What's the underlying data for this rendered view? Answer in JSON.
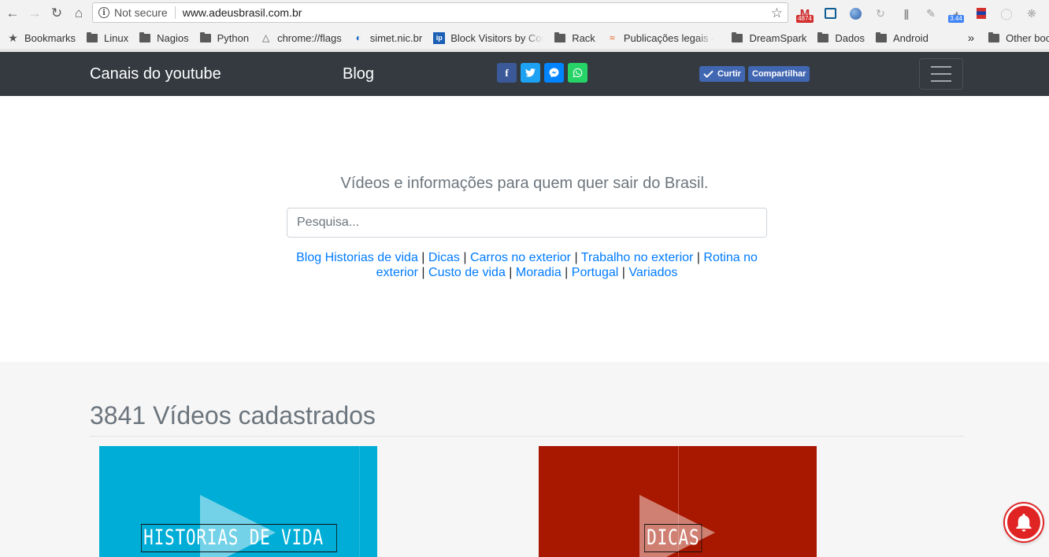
{
  "browser": {
    "security_label": "Not secure",
    "url": "www.adeusbrasil.com.br",
    "extensions": [
      {
        "name": "gmail-extension-icon",
        "badge": "4874",
        "badge_color": "#d32f2f"
      },
      {
        "name": "screenshot-extension-icon"
      },
      {
        "name": "globe-extension-icon"
      },
      {
        "name": "refresh-extension-icon"
      },
      {
        "name": "barcode-extension-icon"
      },
      {
        "name": "pen-extension-icon"
      },
      {
        "name": "speed-extension-icon",
        "badge": "3.44",
        "badge_color": "#4285f4"
      },
      {
        "name": "flag-extension-icon"
      },
      {
        "name": "circle-extension-icon"
      },
      {
        "name": "react-extension-icon"
      }
    ]
  },
  "bookmarks": {
    "label": "Bookmarks",
    "items": [
      {
        "label": "Linux",
        "icon": "folder"
      },
      {
        "label": "Nagios",
        "icon": "folder"
      },
      {
        "label": "Python",
        "icon": "folder"
      },
      {
        "label": "chrome://flags",
        "icon": "flask"
      },
      {
        "label": "simet.nic.br",
        "icon": "gauge"
      },
      {
        "label": "Block Visitors by Cou",
        "icon": "ip"
      },
      {
        "label": "Rack",
        "icon": "folder"
      },
      {
        "label": "Publicações legais -",
        "icon": "wave"
      },
      {
        "label": "DreamSpark",
        "icon": "folder"
      },
      {
        "label": "Dados",
        "icon": "folder"
      },
      {
        "label": "Android",
        "icon": "folder"
      }
    ],
    "overflow": "»",
    "other": "Other bookmarks"
  },
  "navbar": {
    "link1": "Canais do youtube",
    "link2": "Blog",
    "share": {
      "facebook": "f",
      "twitter": "t",
      "messenger": "m",
      "whatsapp": "w"
    },
    "fb_like": "Curtir",
    "fb_share": "Compartilhar"
  },
  "hero": {
    "tagline": "Vídeos e informações para quem quer sair do Brasil.",
    "search_placeholder": "Pesquisa...",
    "categories": [
      "Blog Historias de vida",
      "Dicas",
      "Carros no exterior",
      "Trabalho no exterior",
      "Rotina no exterior",
      "Custo de vida",
      "Moradia",
      "Portugal",
      "Variados"
    ]
  },
  "videos": {
    "count_title": "3841 Vídeos cadastrados",
    "items": [
      {
        "label": "HISTORIAS DE VIDA",
        "color": "#00add6"
      },
      {
        "label": "DICAS",
        "color": "#a81800"
      }
    ]
  },
  "colors": {
    "navbar": "#343a40",
    "link": "#007bff",
    "facebook": "#3b5998",
    "twitter": "#1da1f2",
    "messenger": "#0084ff",
    "whatsapp": "#25d366"
  }
}
